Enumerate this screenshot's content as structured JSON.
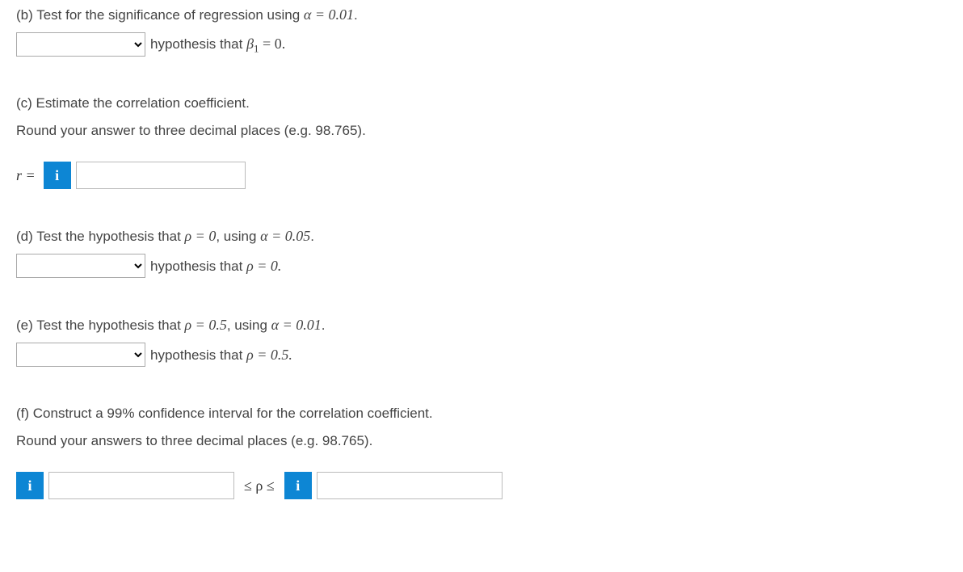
{
  "questions": {
    "b": {
      "prompt_prefix": "(b) Test for the significance of regression using ",
      "alpha_expr": "α = 0.01",
      "period": ".",
      "hypothesis_prefix": "hypothesis that ",
      "beta_expr_var": "β",
      "beta_sub": "1",
      "beta_eq": " = 0."
    },
    "c": {
      "prompt": "(c) Estimate the correlation coefficient.",
      "round_instr": "Round your answer to three decimal places (e.g. 98.765).",
      "r_label": "r ="
    },
    "d": {
      "prompt_prefix": "(d) Test the hypothesis that ",
      "rho_expr": "ρ = 0",
      "middle": ", using ",
      "alpha_expr": "α = 0.05",
      "period": ".",
      "hypothesis_prefix": "hypothesis that ",
      "hyp_rho": "ρ = 0."
    },
    "e": {
      "prompt_prefix": "(e) Test the hypothesis that ",
      "rho_expr": "ρ = 0.5",
      "middle": ", using ",
      "alpha_expr": "α = 0.01",
      "period": ".",
      "hypothesis_prefix": "hypothesis that ",
      "hyp_rho": "ρ = 0.5."
    },
    "f": {
      "prompt": "(f) Construct a 99% confidence interval for the correlation coefficient.",
      "round_instr": "Round your answers to three decimal places (e.g. 98.765).",
      "interval_mid": "≤ ρ ≤"
    }
  },
  "icons": {
    "info": "i"
  }
}
